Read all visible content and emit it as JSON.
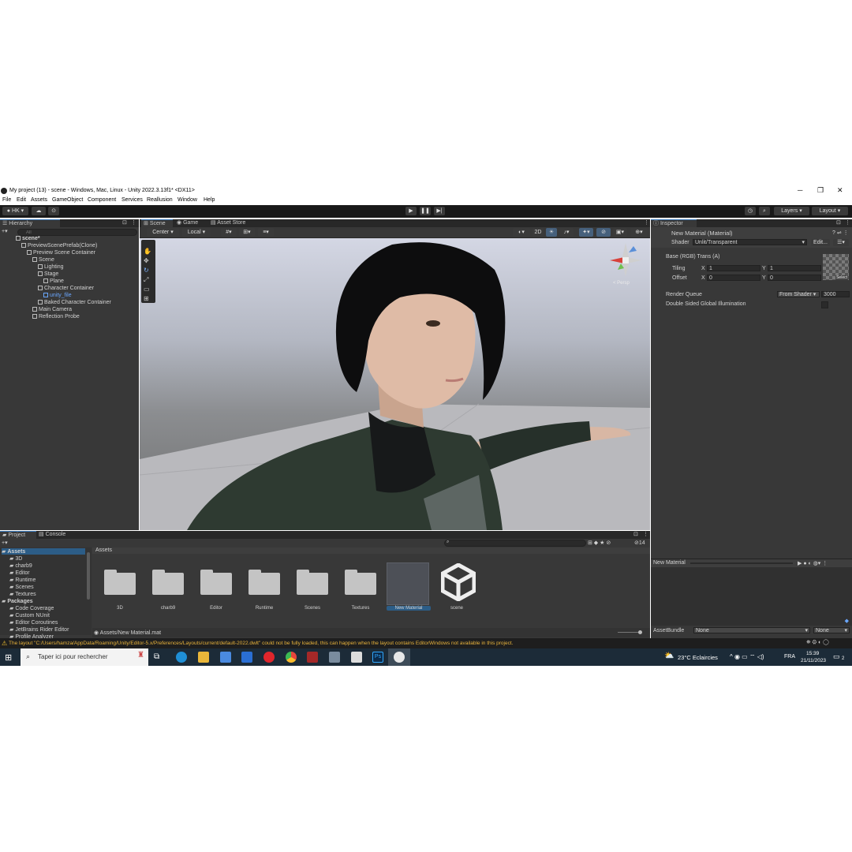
{
  "window": {
    "title": "My project (13) - scene - Windows, Mac, Linux - Unity 2022.3.13f1* <DX11>",
    "controls": [
      "─",
      "❐",
      "✕"
    ]
  },
  "menu": [
    "File",
    "Edit",
    "Assets",
    "GameObject",
    "Component",
    "Services",
    "Reallusion",
    "Window",
    "Help"
  ],
  "toolbar": {
    "account": "HK",
    "layers": "Layers",
    "layout": "Layout"
  },
  "hierarchy": {
    "tab": "Hierarchy",
    "search_placeholder": "All",
    "items": [
      {
        "label": "scene*",
        "depth": 0
      },
      {
        "label": "PreviewScenePrefab(Clone)",
        "depth": 1
      },
      {
        "label": "Preview Scene Container",
        "depth": 2
      },
      {
        "label": "Scene",
        "depth": 3
      },
      {
        "label": "Lighting",
        "depth": 4
      },
      {
        "label": "Stage",
        "depth": 4
      },
      {
        "label": "Plane",
        "depth": 5
      },
      {
        "label": "Character Container",
        "depth": 4
      },
      {
        "label": "unity_file",
        "depth": 5
      },
      {
        "label": "Baked Character Container",
        "depth": 4
      },
      {
        "label": "Main Camera",
        "depth": 3
      },
      {
        "label": "Reflection Probe",
        "depth": 3
      }
    ]
  },
  "scene_tabs": [
    "Scene",
    "Game",
    "Asset Store"
  ],
  "scene_toolbar": {
    "pivot": "Center",
    "space": "Local",
    "mode_2d": "2D",
    "gizmo_label": "< Persp"
  },
  "inspector": {
    "tab": "Inspector",
    "title": "New Material (Material)",
    "shader_label": "Shader",
    "shader_value": "Unlit/Transparent",
    "edit_button": "Edit...",
    "texture_label": "Base (RGB) Trans (A)",
    "tiling_label": "Tiling",
    "offset_label": "Offset",
    "x_label": "X",
    "y_label": "Y",
    "tiling_x": "1",
    "tiling_y": "1",
    "offset_x": "0",
    "offset_y": "0",
    "select_button": "Select",
    "render_queue_label": "Render Queue",
    "render_queue_mode": "From Shader",
    "render_queue_value": "3000",
    "double_sided_label": "Double Sided Global Illumination",
    "preview_title": "New Material",
    "assetbundle_label": "AssetBundle",
    "assetbundle_value": "None",
    "assetbundle_variant": "None"
  },
  "project": {
    "tabs": [
      "Project",
      "Console"
    ],
    "tree": [
      {
        "label": "Assets",
        "depth": 0
      },
      {
        "label": "3D",
        "depth": 1
      },
      {
        "label": "charb9",
        "depth": 1
      },
      {
        "label": "Editor",
        "depth": 1
      },
      {
        "label": "Runtime",
        "depth": 1
      },
      {
        "label": "Scenes",
        "depth": 1
      },
      {
        "label": "Textures",
        "depth": 1
      },
      {
        "label": "Packages",
        "depth": 0
      },
      {
        "label": "Code Coverage",
        "depth": 1
      },
      {
        "label": "Custom NUnit",
        "depth": 1
      },
      {
        "label": "Editor Coroutines",
        "depth": 1
      },
      {
        "label": "JetBrains Rider Editor",
        "depth": 1
      },
      {
        "label": "Profile Analyzer",
        "depth": 1
      }
    ],
    "breadcrumb": "Assets",
    "items": [
      "3D",
      "charb9",
      "Editor",
      "Runtime",
      "Scenes",
      "Textures",
      "New Material",
      "scene"
    ],
    "selected_path": "Assets/New Material.mat",
    "count": "14"
  },
  "status": "The layout \"C:/Users/hamza/AppData/Roaming/Unity/Editor-5.x/Preferences/Layouts/current/default-2022.dwlt\" could not be fully loaded, this can happen when the layout contains EditorWindows not available in this project.",
  "taskbar": {
    "search_placeholder": "Taper ici pour rechercher",
    "weather": "23°C  Eclaircies",
    "lang": "FRA",
    "time": "15:39",
    "date": "21/11/2023",
    "notif": "2"
  }
}
